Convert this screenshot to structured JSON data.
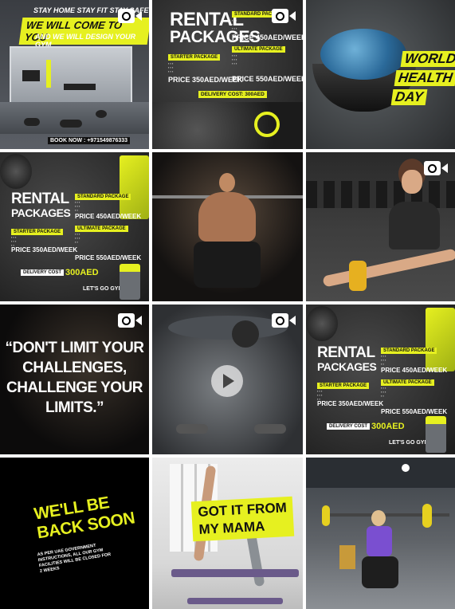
{
  "tiles": {
    "t0": {
      "headline": "STAY HOME STAY FIT STAY SAFE",
      "banner": "WE WILL COME TO YOU",
      "subline": "AND WE WILL DESIGN YOUR GYM",
      "footer": "BOOK NOW : +971549876333",
      "badge": "video-icon"
    },
    "t1": {
      "title_line1": "RENTAL",
      "title_line2": "PACKAGES",
      "starter_label": "STARTER PACKAGE",
      "starter_price": "PRICE 350AED/WEEK",
      "standard_label": "STANDARD PACKAGE",
      "standard_price": "PRICE 450AED/WEEK",
      "ultimate_label": "ULTIMATE PACKAGE",
      "ultimate_price": "PRICE 550AED/WEEK",
      "delivery": "DELIVERY COST: 300AED",
      "badge": "video-icon"
    },
    "t2": {
      "line1": "WORLD",
      "line2": "HEALTH",
      "line3": "DAY"
    },
    "t3": {
      "title_line1": "RENTAL",
      "title_line2": "PACKAGES",
      "standard_label": "STANDARD PACKAGE",
      "standard_price": "PRICE 450AED/WEEK",
      "starter_label": "STARTER PACKAGE",
      "starter_price": "PRICE 350AED/WEEK",
      "ultimate_label": "ULTIMATE PACKAGE",
      "ultimate_price": "PRICE 550AED/WEEK",
      "delivery_label": "DELIVERY COST",
      "delivery_value": "300AED",
      "logo": "LET'S GO GYM"
    },
    "t4": {
      "badge": "video-icon"
    },
    "t5": {
      "badge": "video-icon"
    },
    "t6": {
      "quote": "“DON'T LIMIT YOUR CHALLENGES, CHALLENGE YOUR LIMITS.”",
      "badge": "video-icon"
    },
    "t7": {
      "badge": "video-icon"
    },
    "t8": {
      "title_line1": "RENTAL",
      "title_line2": "PACKAGES",
      "standard_label": "STANDARD PACKAGE",
      "standard_price": "PRICE 450AED/WEEK",
      "starter_label": "STARTER PACKAGE",
      "starter_price": "PRICE 350AED/WEEK",
      "ultimate_label": "ULTIMATE PACKAGE",
      "ultimate_price": "PRICE 550AED/WEEK",
      "delivery_label": "DELIVERY COST",
      "delivery_value": "300AED",
      "logo": "LET'S GO GYM"
    },
    "t9": {
      "line1": "WE'LL BE",
      "line2": "BACK SOON",
      "notice": "AS PER UAE GOVERNMENT INSTRUCTIONS, ALL OUR GYM FACILITIES WILL BE CLOSED FOR 2 WEEKS"
    },
    "t10": {
      "line1": "GOT IT FROM",
      "line2": "MY MAMA"
    }
  },
  "colors": {
    "accent": "#e6f020",
    "dark": "#1c1c1c"
  }
}
